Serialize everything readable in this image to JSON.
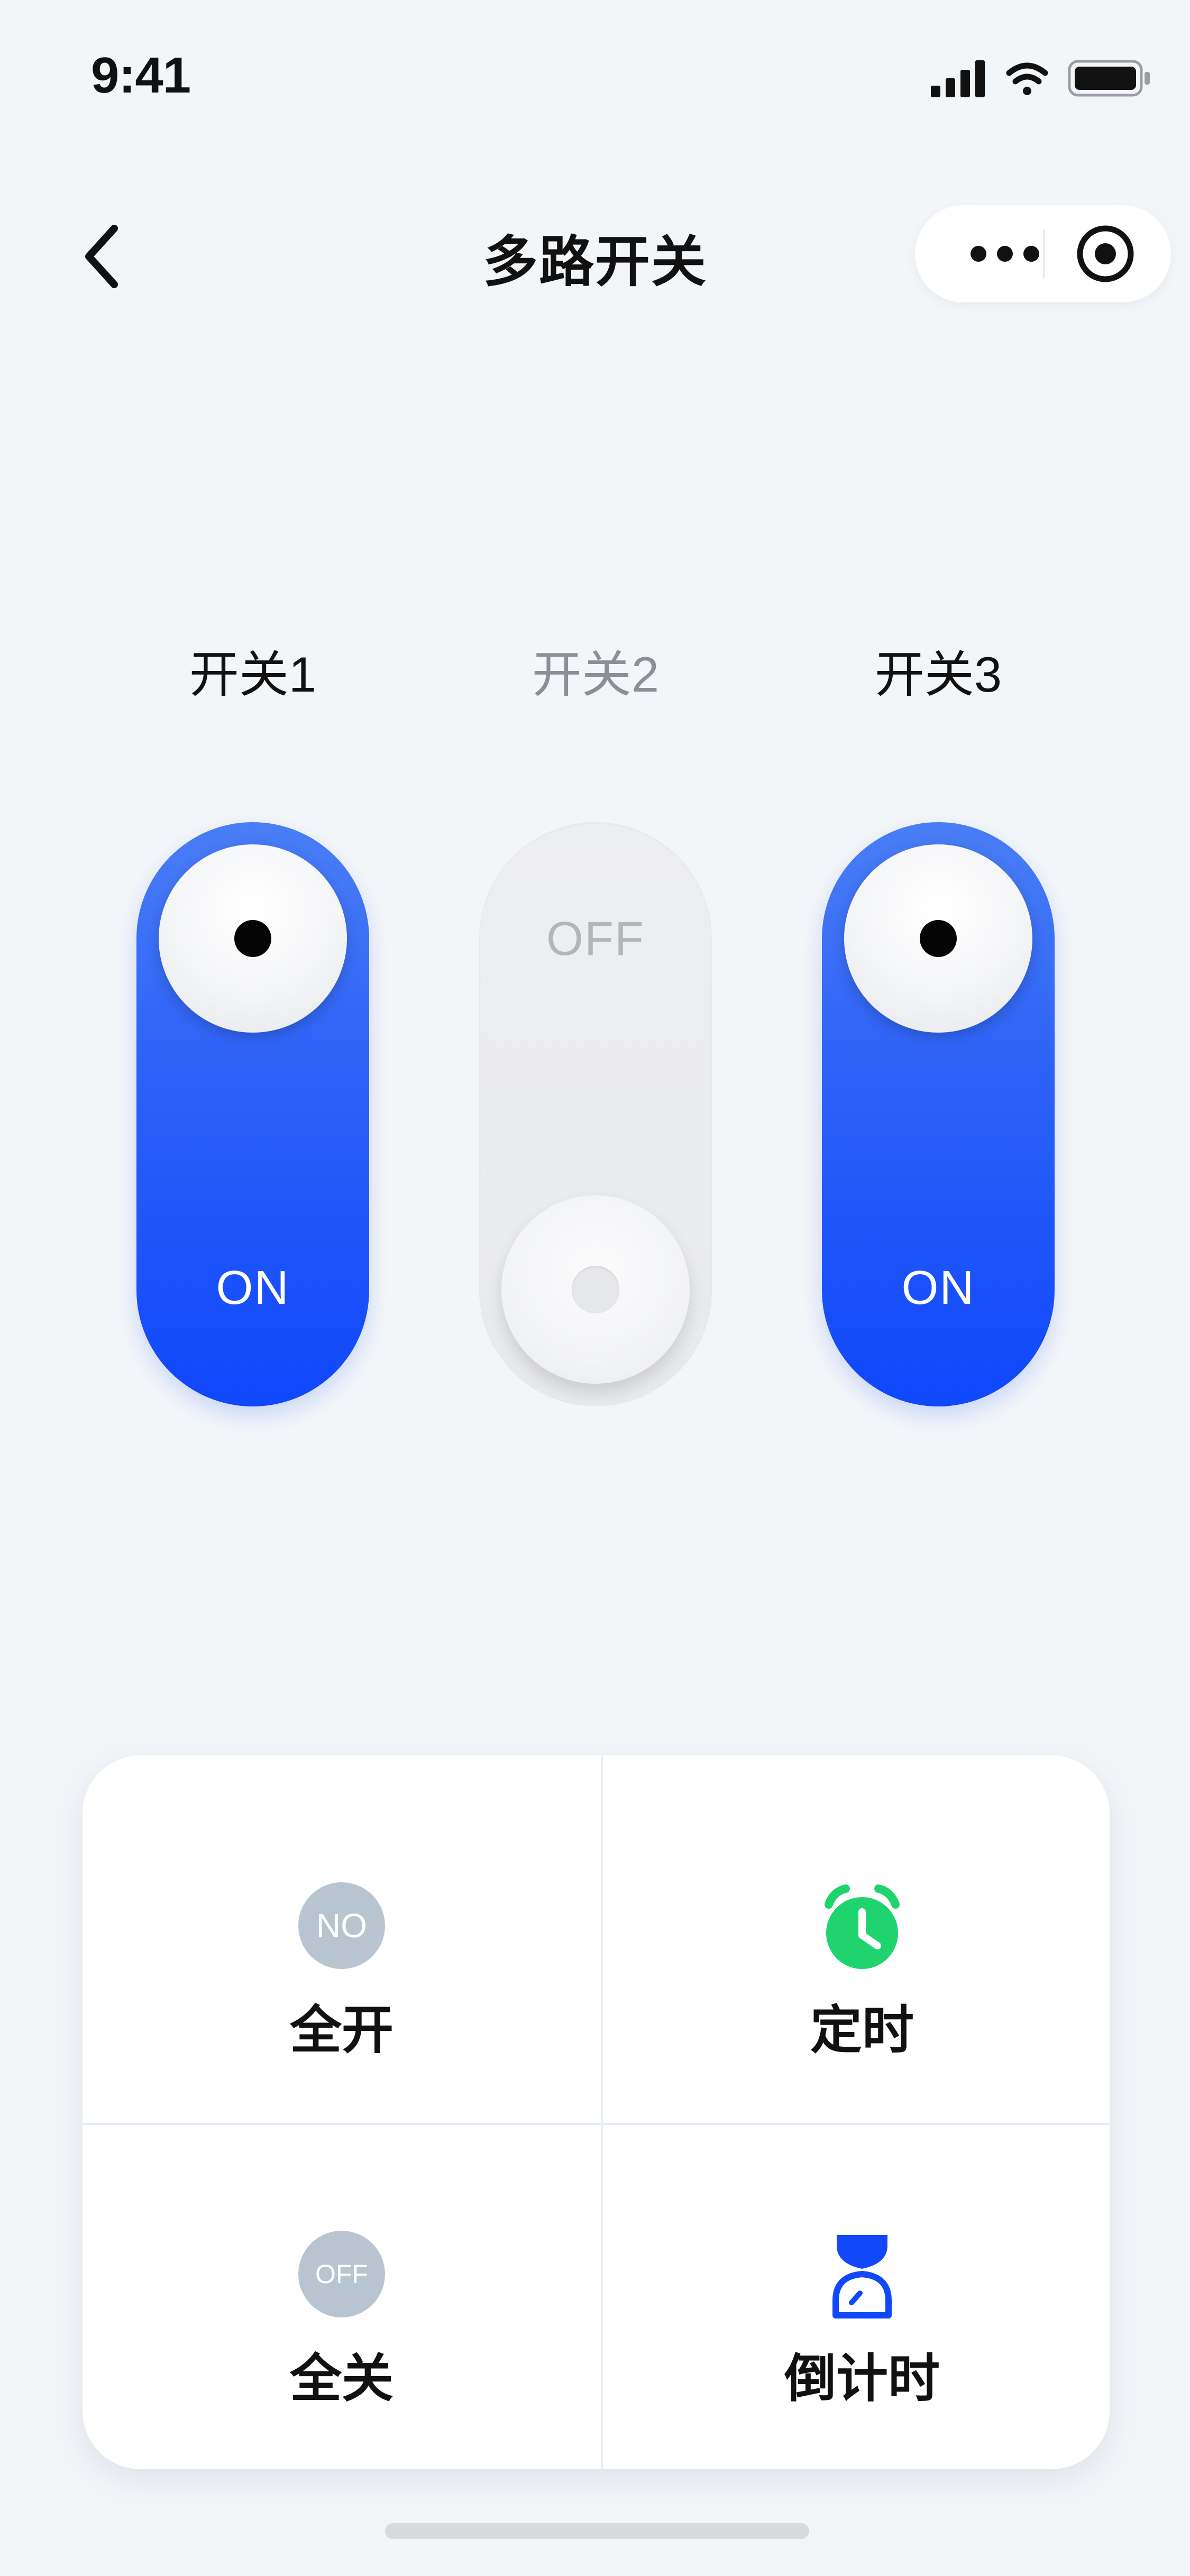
{
  "status_bar": {
    "time": "9:41"
  },
  "nav": {
    "title": "多路开关"
  },
  "switches": [
    {
      "label": "开关1",
      "state_text": "ON",
      "on": true
    },
    {
      "label": "开关2",
      "state_text": "OFF",
      "on": false
    },
    {
      "label": "开关3",
      "state_text": "ON",
      "on": true
    }
  ],
  "actions": {
    "all_on": {
      "badge": "NO",
      "label": "全开"
    },
    "timer": {
      "label": "定时"
    },
    "all_off": {
      "badge": "OFF",
      "label": "全关"
    },
    "countdown": {
      "label": "倒计时"
    }
  },
  "colors": {
    "accent_blue": "#1149fa",
    "timer_green": "#1fd36f",
    "badge_gray": "#b8c5d1"
  }
}
